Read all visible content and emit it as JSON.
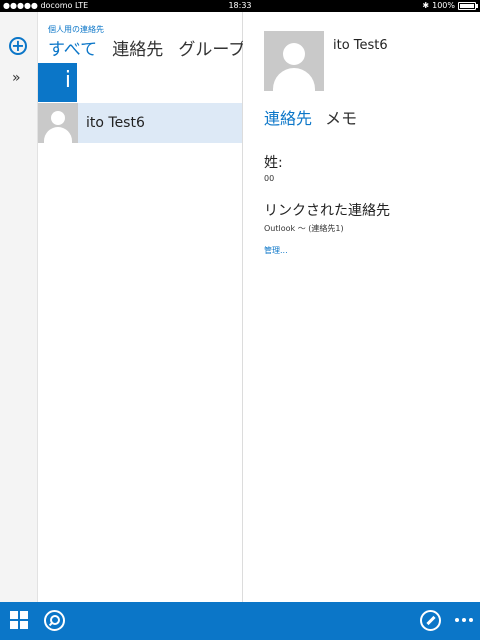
{
  "status_bar": {
    "carrier": "●●●●● docomo  LTE",
    "time": "18:33",
    "battery_pct": "100%"
  },
  "list": {
    "subtitle": "個人用の連絡先",
    "tabs": [
      {
        "label": "すべて",
        "active": true
      },
      {
        "label": "連絡先",
        "active": false
      },
      {
        "label": "グループ",
        "active": false
      }
    ],
    "index_letter": "i",
    "contacts": [
      {
        "name": "ito Test6",
        "selected": true
      }
    ]
  },
  "detail": {
    "name": "ito Test6",
    "tabs": [
      {
        "label": "連絡先",
        "active": true
      },
      {
        "label": "メモ",
        "active": false
      }
    ],
    "surname_label": "姓:",
    "surname_value": "00",
    "linked_label": "リンクされた連絡先",
    "linked_value": "Outlook 〜 (連絡先1)",
    "manage_link": "管理..."
  },
  "colors": {
    "accent": "#0b76c8",
    "selected_row": "#dde9f6"
  },
  "icons": {
    "add": "add-circle-icon",
    "expand": "double-chevron-right-icon",
    "tiles": "tiles-icon",
    "search": "search-icon",
    "edit": "edit-icon",
    "more": "more-icon"
  }
}
